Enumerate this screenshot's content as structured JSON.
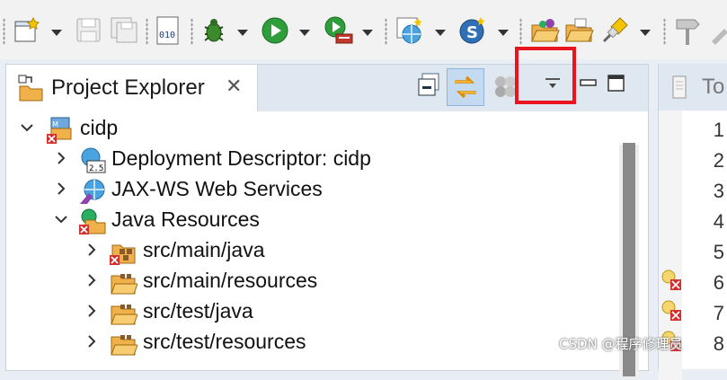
{
  "toolbar": {
    "icons": [
      "new-wizard-icon",
      "save-icon",
      "save-all-icon",
      "binary-icon",
      "debug-icon",
      "run-icon",
      "run-server-icon",
      "web-service-icon",
      "new-class-icon",
      "open-folder-icon",
      "open-project-icon",
      "pin-icon",
      "dropdown-icon"
    ]
  },
  "explorer": {
    "tab_title": "Project Explorer",
    "close_glyph": "✕",
    "tree": [
      {
        "label": "cidp",
        "expanded": true,
        "icon": "project-icon"
      },
      {
        "label": "Deployment Descriptor: cidp",
        "expanded": false,
        "icon": "deployment-descriptor-icon"
      },
      {
        "label": "JAX-WS Web Services",
        "expanded": false,
        "icon": "web-services-icon"
      },
      {
        "label": "Java Resources",
        "expanded": true,
        "icon": "java-resources-icon"
      },
      {
        "label": "src/main/java",
        "expanded": false,
        "icon": "source-folder-error-icon"
      },
      {
        "label": "src/main/resources",
        "expanded": false,
        "icon": "source-folder-icon"
      },
      {
        "label": "src/test/java",
        "expanded": false,
        "icon": "source-folder-icon"
      },
      {
        "label": "src/test/resources",
        "expanded": false,
        "icon": "source-folder-icon"
      }
    ]
  },
  "editor": {
    "tab_title": "To",
    "line_numbers": [
      "1",
      "2",
      "3",
      "4",
      "5",
      "6",
      "7",
      "8"
    ]
  },
  "watermark": "CSDN @程序修理员",
  "colors": {
    "highlight": "#e8141e",
    "header_bg": "#dfe8f1",
    "run_green": "#2e9e3a"
  }
}
